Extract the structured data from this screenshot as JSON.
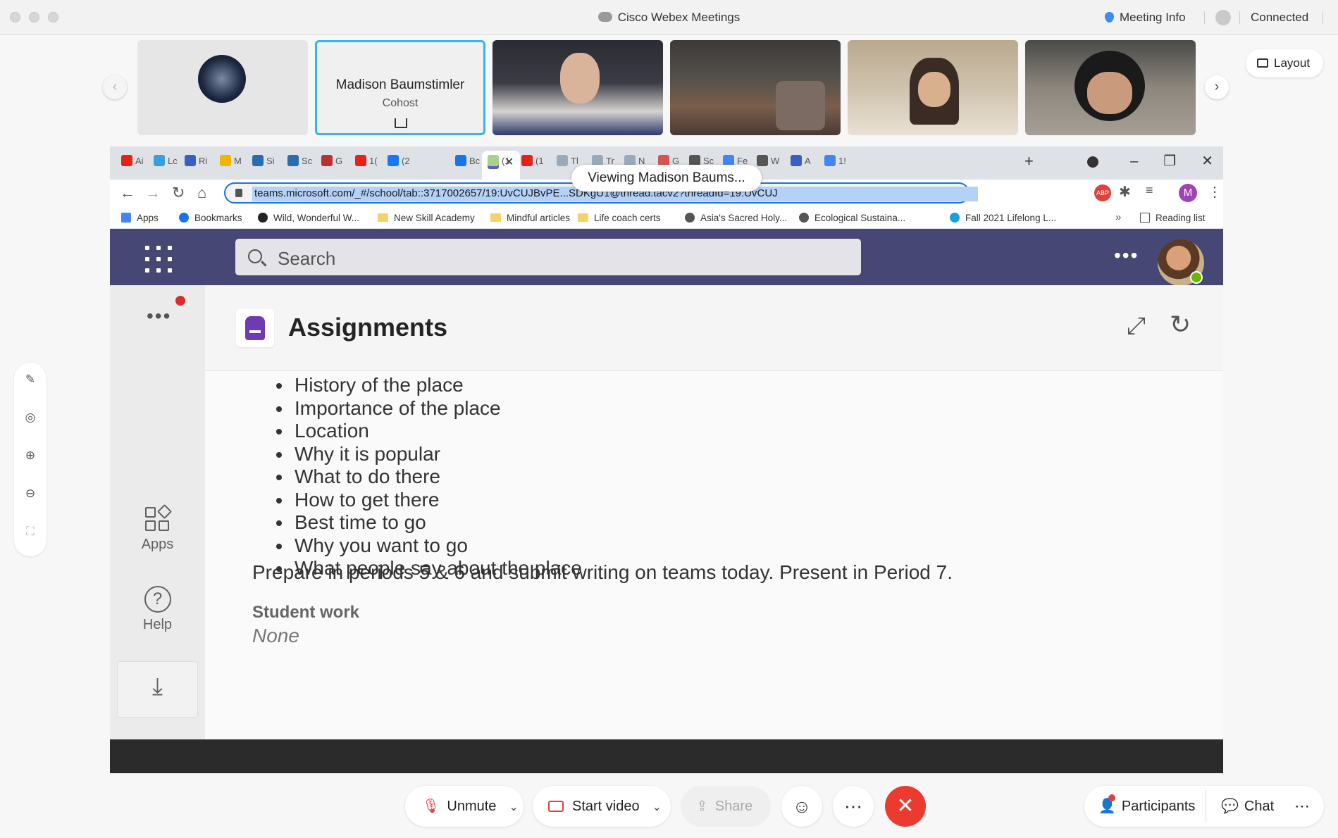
{
  "window": {
    "title": "Cisco Webex Meetings",
    "meeting_info": "Meeting Info",
    "status": "Connected"
  },
  "strip": {
    "layout_label": "Layout",
    "presenter": {
      "name": "Madison Baumstimler",
      "role": "Cohost"
    }
  },
  "browser": {
    "tabs": [
      "Ai",
      "Lc",
      "Ri",
      "M",
      "Si",
      "Sc",
      "G",
      "1(",
      "(2",
      "Bc",
      "(1",
      "(1",
      "Tl",
      "Tr",
      "N",
      "G",
      "Sc",
      "Fe",
      "W",
      "A",
      "1!"
    ],
    "viewing_tooltip": "Viewing Madison Baums...",
    "url": "teams.microsoft.com/_#/school/tab::3717002657/19:UvCUJBvPE...SDKgU1@thread.tacv2?threadId=19:UvCUJ",
    "profile_initial": "M",
    "bookmarks": [
      "Apps",
      "Bookmarks",
      "Wild, Wonderful W...",
      "New Skill Academy",
      "Mindful articles",
      "Life coach certs",
      "Asia's Sacred Holy...",
      "Ecological Sustaina...",
      "Fall 2021 Lifelong L..."
    ],
    "reading_list": "Reading list"
  },
  "teams": {
    "search_placeholder": "Search",
    "rail": {
      "apps": "Apps",
      "help": "Help"
    },
    "page_title": "Assignments",
    "tasks": [
      "History of the place",
      "Importance of the place",
      "Location",
      "Why it is popular",
      "What to do there",
      "How to get there",
      "Best time to go",
      "Why you want to go",
      "What people say about the place"
    ],
    "instructions": "Prepare in periods 5 & 6 and submit writing on teams today. Present in Period 7.",
    "student_work_label": "Student work",
    "student_work_value": "None"
  },
  "controls": {
    "unmute": "Unmute",
    "start_video": "Start video",
    "share": "Share",
    "participants": "Participants",
    "chat": "Chat"
  },
  "colors": {
    "teams_header": "#464775",
    "assignment_icon": "#6e3bb0",
    "leave_button": "#ea3b2e",
    "selection_highlight": "#b4d2f7"
  }
}
